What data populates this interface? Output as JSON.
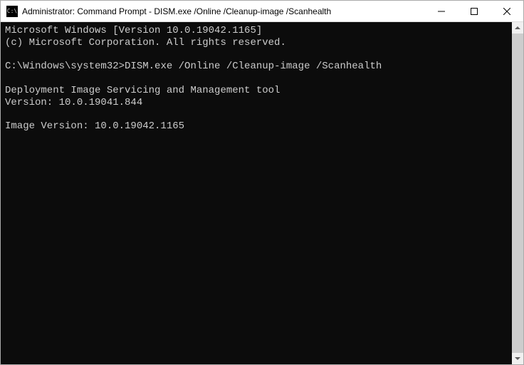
{
  "titlebar": {
    "icon_label": "C:\\",
    "title": "Administrator: Command Prompt - DISM.exe  /Online /Cleanup-image /Scanhealth"
  },
  "console": {
    "line1": "Microsoft Windows [Version 10.0.19042.1165]",
    "line2": "(c) Microsoft Corporation. All rights reserved.",
    "blank1": "",
    "prompt": "C:\\Windows\\system32>",
    "command": "DISM.exe /Online /Cleanup-image /Scanhealth",
    "blank2": "",
    "tool_line": "Deployment Image Servicing and Management tool",
    "version_line": "Version: 10.0.19041.844",
    "blank3": "",
    "image_version_line": "Image Version: 10.0.19042.1165"
  }
}
